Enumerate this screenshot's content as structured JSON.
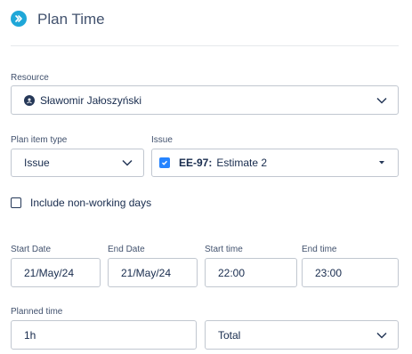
{
  "header": {
    "title": "Plan Time",
    "icon": "double-chevron-right-icon",
    "icon_color": "#1fa7d8"
  },
  "resource": {
    "label": "Resource",
    "value": "Sławomir Jałoszyński",
    "icon": "user-avatar-icon"
  },
  "plan_item_type": {
    "label": "Plan item type",
    "value": "Issue"
  },
  "issue": {
    "label": "Issue",
    "key": "EE-97:",
    "summary": "Estimate 2",
    "icon": "task-checkbox-icon",
    "icon_color": "#2684ff"
  },
  "include_nonworking": {
    "label": "Include non-working days",
    "checked": false
  },
  "start_date": {
    "label": "Start Date",
    "value": "21/May/24"
  },
  "end_date": {
    "label": "End Date",
    "value": "21/May/24"
  },
  "start_time": {
    "label": "Start time",
    "value": "22:00"
  },
  "end_time": {
    "label": "End time",
    "value": "23:00"
  },
  "planned_time": {
    "label": "Planned time",
    "value": "1h",
    "unit": "Total"
  }
}
